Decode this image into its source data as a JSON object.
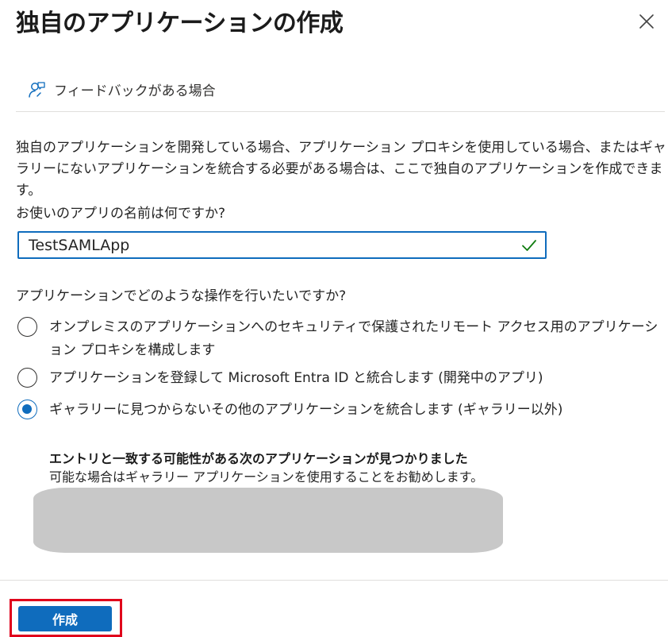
{
  "dialog": {
    "title": "独自のアプリケーションの作成",
    "close_icon": "close-icon"
  },
  "feedback": {
    "icon": "person-feedback-icon",
    "label": "フィードバックがある場合"
  },
  "description": "独自のアプリケーションを開発している場合、アプリケーション プロキシを使用している場合、またはギャラリーにないアプリケーションを統合する必要がある場合は、ここで独自のアプリケーションを作成できます。",
  "name_question": {
    "label": "お使いのアプリの名前は何ですか?",
    "value": "TestSAMLApp",
    "valid_icon": "checkmark-icon"
  },
  "action_question": {
    "label": "アプリケーションでどのような操作を行いたいですか?",
    "options": [
      {
        "label": "オンプレミスのアプリケーションへのセキュリティで保護されたリモート アクセス用のアプリケーション プロキシを構成します",
        "selected": false
      },
      {
        "label": "アプリケーションを登録して Microsoft Entra ID と統合します (開発中のアプリ)",
        "selected": false
      },
      {
        "label": "ギャラリーに見つからないその他のアプリケーションを統合します (ギャラリー以外)",
        "selected": true
      }
    ]
  },
  "suggestions": {
    "title": "エントリと一致する可能性がある次のアプリケーションが見つかりました",
    "subtitle": "可能な場合はギャラリー アプリケーションを使用することをお勧めします。"
  },
  "footer": {
    "create_label": "作成"
  },
  "colors": {
    "accent": "#0f6cbd",
    "highlight": "#e0001b",
    "valid": "#107c10"
  }
}
